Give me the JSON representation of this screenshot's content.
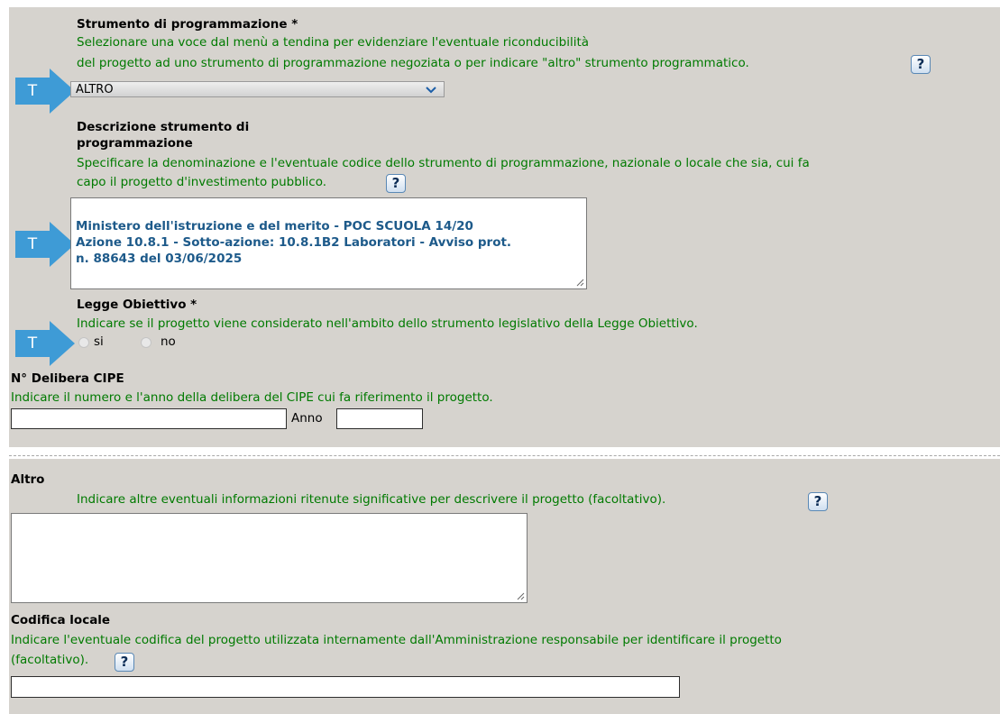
{
  "strumento": {
    "label": "Strumento di programmazione *",
    "help_line1": "Selezionare una voce dal menù a tendina per evidenziare l'eventuale riconducibilità",
    "help_line2": "del progetto ad uno strumento di programmazione negoziata o per indicare \"altro\" strumento programmatico.",
    "selected": "ALTRO"
  },
  "descrizione": {
    "label_line1": "Descrizione strumento di",
    "label_line2": "programmazione",
    "help_line1": "Specificare la denominazione e l'eventuale codice dello strumento di programmazione, nazionale o locale che sia, cui fa",
    "help_line2": "capo il progetto d'investimento pubblico.",
    "value": "Ministero dell'istruzione e del merito - POC SCUOLA 14/20\nAzione 10.8.1 - Sotto-azione: 10.8.1B2 Laboratori - Avviso prot.\nn. 88643 del 03/06/2025"
  },
  "legge": {
    "label": "Legge Obiettivo *",
    "help": "Indicare se il progetto viene considerato nell'ambito dello strumento legislativo della Legge Obiettivo.",
    "opt_si": "si",
    "opt_no": "no"
  },
  "delibera": {
    "label": "N° Delibera CIPE",
    "help": "Indicare il numero e l'anno della delibera del CIPE cui fa riferimento il progetto.",
    "anno_label": "Anno",
    "numero_value": "",
    "anno_value": ""
  },
  "altro": {
    "label": "Altro",
    "help": "Indicare altre eventuali informazioni ritenute significative per descrivere il progetto (facoltativo).",
    "value": ""
  },
  "codifica": {
    "label": "Codifica locale",
    "help_line1": "Indicare l'eventuale codifica del progetto utilizzata internamente dall'Amministrazione responsabile per identificare il progetto",
    "help_line2": "(facoltativo).",
    "value": ""
  },
  "help_icon_text": "?",
  "t_marker_text": "T",
  "icons": [
    "help-icon",
    "t-marker-icon",
    "chevron-down-icon",
    "resize-grip-icon"
  ],
  "colors": {
    "panel_bg": "#d6d3ce",
    "help_text": "#007a00",
    "marker": "#3e9bd6",
    "textarea_text": "#1d5a8a"
  }
}
